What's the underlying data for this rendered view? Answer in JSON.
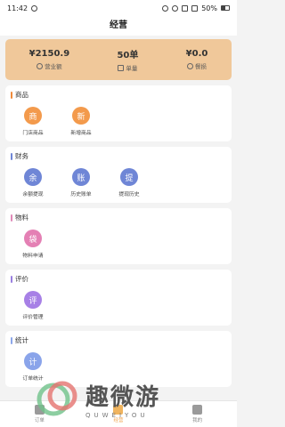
{
  "status": {
    "time": "11:42",
    "battery": "50%"
  },
  "header": {
    "title": "经营"
  },
  "summary": [
    {
      "value": "¥2150.9",
      "label": "营业额"
    },
    {
      "value": "50单",
      "label": "单量"
    },
    {
      "value": "¥0.0",
      "label": "餐损"
    }
  ],
  "sections": {
    "goods": {
      "title": "商品",
      "items": [
        {
          "glyph": "商",
          "label": "门店商品"
        },
        {
          "glyph": "新",
          "label": "新增商品"
        }
      ]
    },
    "finance": {
      "title": "财务",
      "items": [
        {
          "glyph": "余",
          "label": "余额提现"
        },
        {
          "glyph": "账",
          "label": "历史账单"
        },
        {
          "glyph": "提",
          "label": "提现历史"
        }
      ]
    },
    "materials": {
      "title": "物料",
      "items": [
        {
          "glyph": "袋",
          "label": "物料申请"
        }
      ]
    },
    "reviews": {
      "title": "评价",
      "items": [
        {
          "glyph": "评",
          "label": "评价管理"
        }
      ]
    },
    "stats": {
      "title": "统计",
      "items": [
        {
          "glyph": "计",
          "label": "订单统计"
        }
      ]
    }
  },
  "tabbar": {
    "tabs": [
      "订单",
      "经营",
      "我的"
    ]
  },
  "watermark": {
    "text": "趣微游",
    "sub": "QUWEIYOU"
  }
}
